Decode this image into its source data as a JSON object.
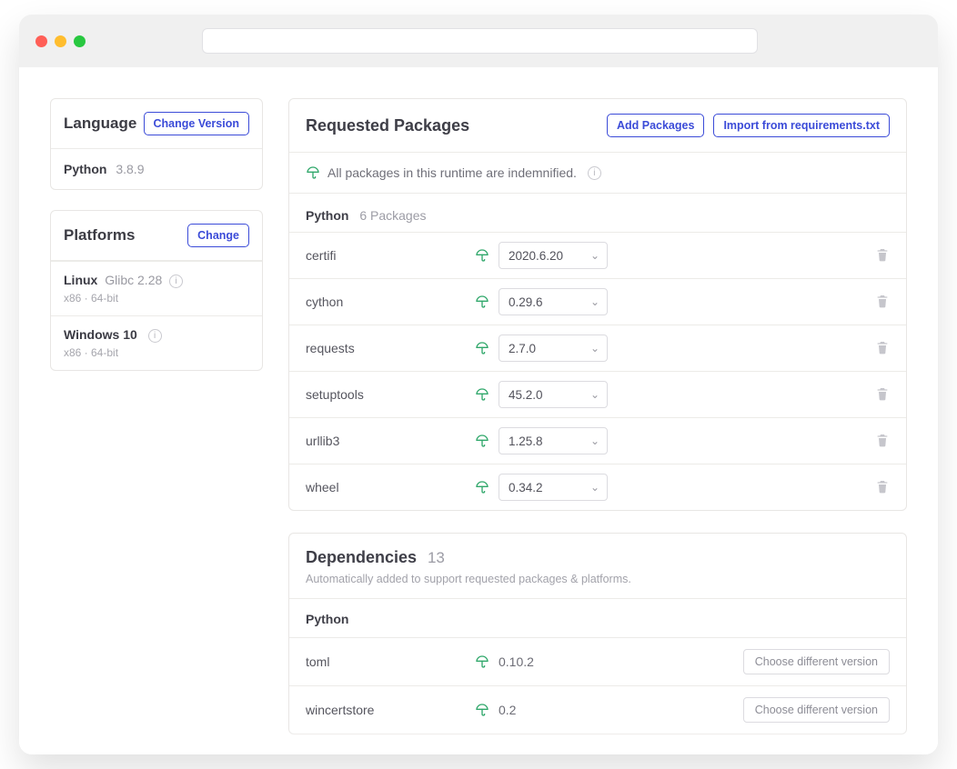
{
  "sidebar": {
    "language": {
      "title": "Language",
      "change_label": "Change Version",
      "name": "Python",
      "version": "3.8.9"
    },
    "platforms": {
      "title": "Platforms",
      "change_label": "Change",
      "items": [
        {
          "name": "Linux",
          "extra": "Glibc 2.28",
          "meta": "x86 · 64-bit"
        },
        {
          "name": "Windows 10",
          "extra": "",
          "meta": "x86 · 64-bit"
        }
      ]
    }
  },
  "requested": {
    "title": "Requested Packages",
    "add_label": "Add Packages",
    "import_label": "Import from requirements.txt",
    "indemnified_text": "All packages in this runtime are indemnified.",
    "section_name": "Python",
    "section_count": "6 Packages",
    "packages": [
      {
        "name": "certifi",
        "version": "2020.6.20"
      },
      {
        "name": "cython",
        "version": "0.29.6"
      },
      {
        "name": "requests",
        "version": "2.7.0"
      },
      {
        "name": "setuptools",
        "version": "45.2.0"
      },
      {
        "name": "urllib3",
        "version": "1.25.8"
      },
      {
        "name": "wheel",
        "version": "0.34.2"
      }
    ]
  },
  "dependencies": {
    "title": "Dependencies",
    "count": "13",
    "subtitle": "Automatically added to support requested packages & platforms.",
    "section_name": "Python",
    "choose_label": "Choose different version",
    "items": [
      {
        "name": "toml",
        "version": "0.10.2"
      },
      {
        "name": "wincertstore",
        "version": "0.2"
      }
    ]
  },
  "colors": {
    "accent": "#3b4bd8",
    "indemnified": "#2fa76a"
  }
}
